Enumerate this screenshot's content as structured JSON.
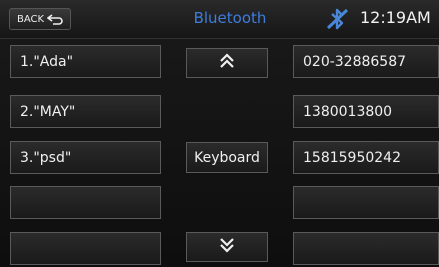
{
  "header": {
    "back_label": "BACK",
    "title": "Bluetooth",
    "time": "12:19AM",
    "bluetooth_icon": "bluetooth-disconnected-icon"
  },
  "contacts": [
    {
      "name": "1.\"Ada\"",
      "number": "020-32886587"
    },
    {
      "name": "2.\"MAY\"",
      "number": "1380013800"
    },
    {
      "name": "3.\"psd\"",
      "number": "15815950242"
    },
    {
      "name": "",
      "number": ""
    },
    {
      "name": "",
      "number": ""
    }
  ],
  "controls": {
    "keyboard_label": "Keyboard",
    "scroll_up_icon": "double-chevron-up-icon",
    "scroll_down_icon": "double-chevron-down-icon"
  },
  "colors": {
    "title": "#3c7dde",
    "background": "#141414",
    "button_border": "#5a5a5a"
  }
}
